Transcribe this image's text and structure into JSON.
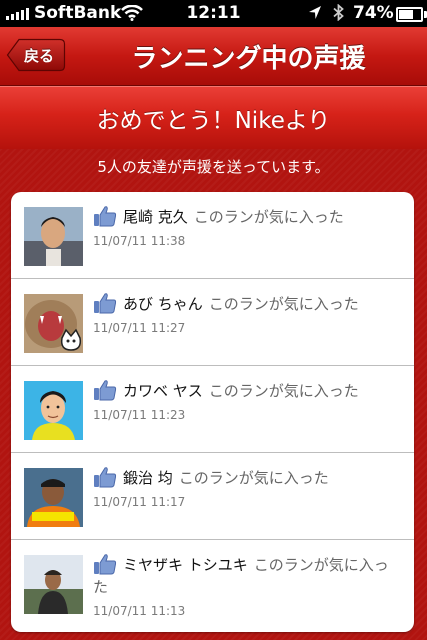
{
  "status_bar": {
    "carrier": "SoftBank",
    "time": "12:11",
    "battery": "74%",
    "battery_level": 0.74
  },
  "nav": {
    "back_label": "戻る",
    "title": "ランニング中の声援"
  },
  "banner": {
    "title": "おめでとう！Nikeより"
  },
  "summary": "5人の友達が声援を送っています。",
  "cheers": [
    {
      "name": "尾崎 克久",
      "action": "このランが気に入った",
      "timestamp": "11/07/11  11:38",
      "avatar": "man-portrait"
    },
    {
      "name": "あび ちゃん",
      "action": "このランが気に入った",
      "timestamp": "11/07/11  11:27",
      "avatar": "cat-yawning"
    },
    {
      "name": "カワベ ヤス",
      "action": "このランが気に入った",
      "timestamp": "11/07/11  11:23",
      "avatar": "cartoon-man"
    },
    {
      "name": "鍛治 均",
      "action": "このランが気に入った",
      "timestamp": "11/07/11  11:17",
      "avatar": "man-orange-shirt"
    },
    {
      "name": "ミヤザキ トシユキ",
      "action": "このランが気に入った",
      "timestamp": "11/07/11  11:13",
      "avatar": "person-outdoors"
    }
  ]
}
